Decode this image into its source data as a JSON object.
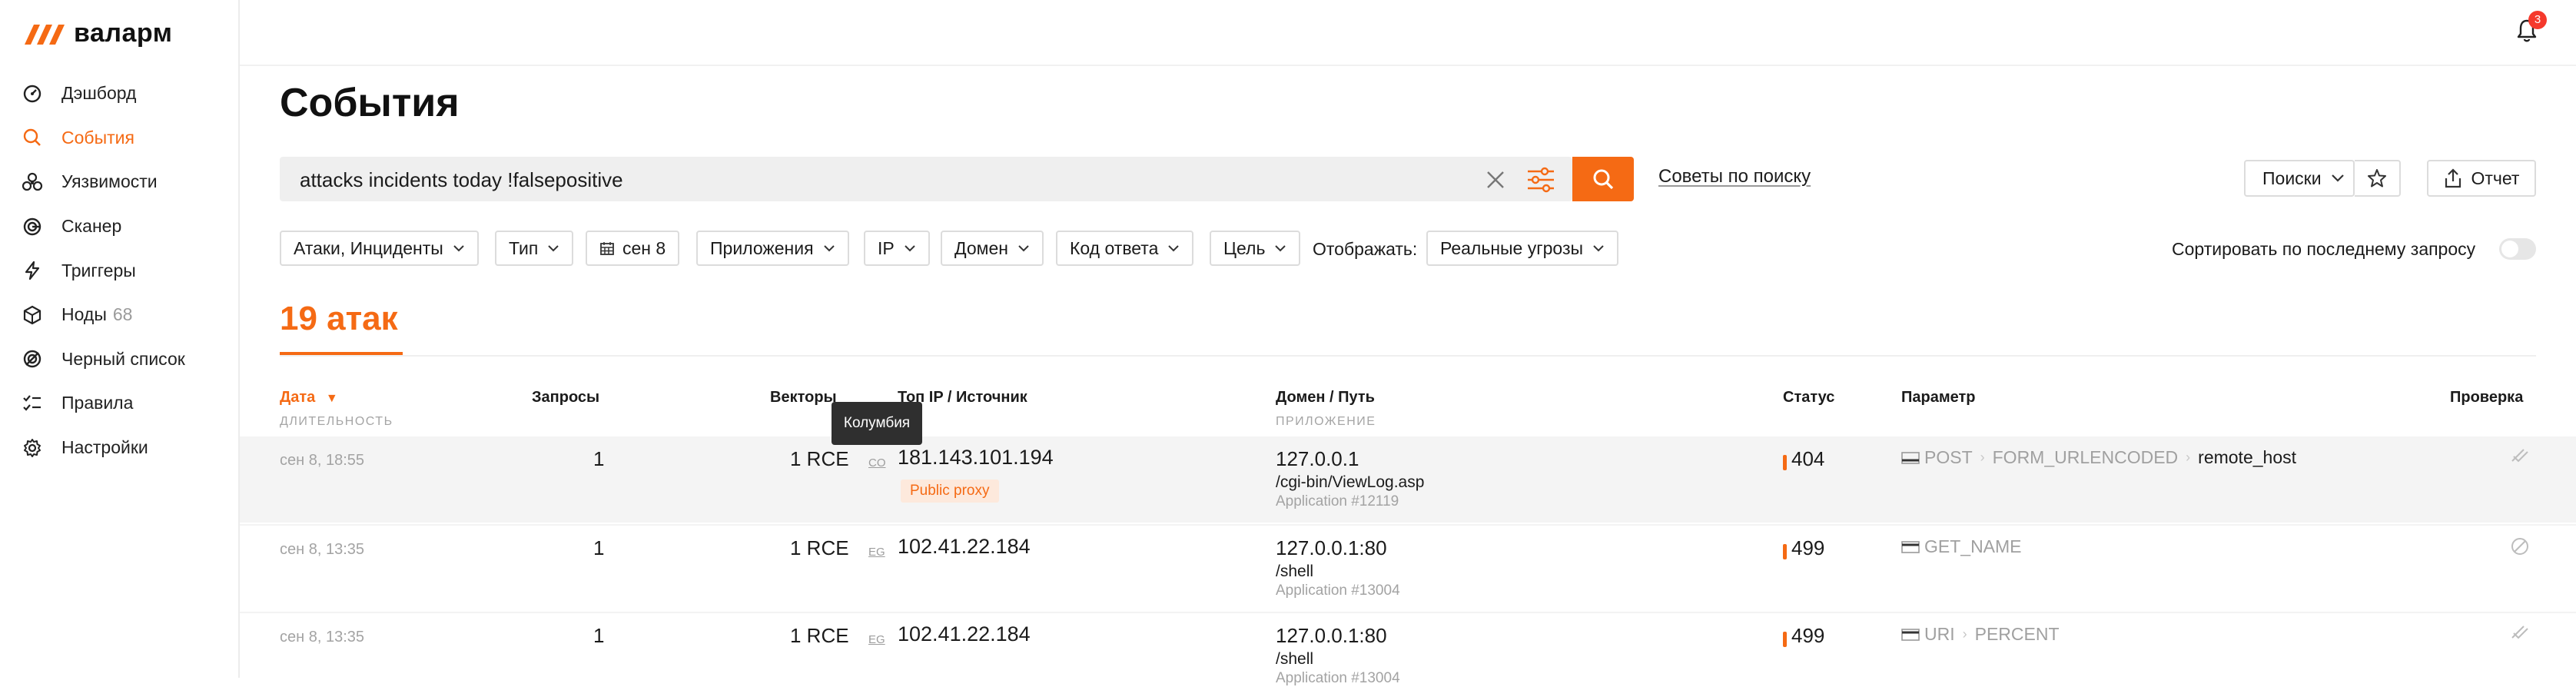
{
  "brand": {
    "name": "валарм",
    "color": "#f56a14"
  },
  "sidebar": {
    "items": [
      {
        "label": "Дэшборд",
        "icon": "dashboard-icon",
        "active": false
      },
      {
        "label": "События",
        "icon": "search-icon",
        "active": true
      },
      {
        "label": "Уязвимости",
        "icon": "biohazard-icon",
        "active": false
      },
      {
        "label": "Сканер",
        "icon": "scanner-icon",
        "active": false
      },
      {
        "label": "Триггеры",
        "icon": "lightning-icon",
        "active": false
      },
      {
        "label": "Ноды",
        "count": "68",
        "icon": "nodes-icon",
        "active": false
      },
      {
        "label": "Черный список",
        "icon": "blacklist-icon",
        "active": false
      },
      {
        "label": "Правила",
        "icon": "rules-icon",
        "active": false
      },
      {
        "label": "Настройки",
        "icon": "gear-icon",
        "active": false
      }
    ]
  },
  "topbar": {
    "notifications_count": "3"
  },
  "page": {
    "title": "События"
  },
  "search": {
    "query": "attacks incidents today !falsepositive",
    "tips_label": "Советы по поиску",
    "saved_label": "Поиски",
    "report_label": "Отчет"
  },
  "filters": {
    "items": [
      "Атаки, Инциденты",
      "Тип",
      "сен 8",
      "Приложения",
      "IP",
      "Домен",
      "Код ответа",
      "Цель"
    ],
    "display_label": "Отображать:",
    "display_value": "Реальные угрозы",
    "sort_label": "Сортировать по последнему запросу",
    "sort_enabled": false
  },
  "summary": {
    "count_label": "19 атак"
  },
  "table": {
    "headers": {
      "date": "Дата",
      "date_sub": "ДЛИТЕЛЬНОСТЬ",
      "requests": "Запросы",
      "vectors": "Векторы",
      "top_ip": "Топ IP / Источник",
      "domain": "Домен / Путь",
      "domain_sub": "ПРИЛОЖЕНИЕ",
      "status": "Статус",
      "param": "Параметр",
      "check": "Проверка"
    },
    "tooltip": "Колумбия",
    "rows": [
      {
        "date": "сен 8, 18:55",
        "requests": "1",
        "vectors": "1 RCE",
        "cc": "CO",
        "ip": "181.143.101.194",
        "badge": "Public proxy",
        "domain": "127.0.0.1",
        "path": "/cgi-bin/ViewLog.asp",
        "app": "Application #12119",
        "status": "404",
        "param": [
          "POST",
          "FORM_URLENCODED",
          "remote_host"
        ]
      },
      {
        "date": "сен 8, 13:35",
        "requests": "1",
        "vectors": "1 RCE",
        "cc": "EG",
        "ip": "102.41.22.184",
        "badge": "",
        "domain": "127.0.0.1:80",
        "path": "/shell",
        "app": "Application #13004",
        "status": "499",
        "param": [
          "GET_NAME"
        ]
      },
      {
        "date": "сен 8, 13:35",
        "requests": "1",
        "vectors": "1 RCE",
        "cc": "EG",
        "ip": "102.41.22.184",
        "badge": "",
        "domain": "127.0.0.1:80",
        "path": "/shell",
        "app": "Application #13004",
        "status": "499",
        "param": [
          "URI",
          "PERCENT"
        ]
      }
    ]
  }
}
